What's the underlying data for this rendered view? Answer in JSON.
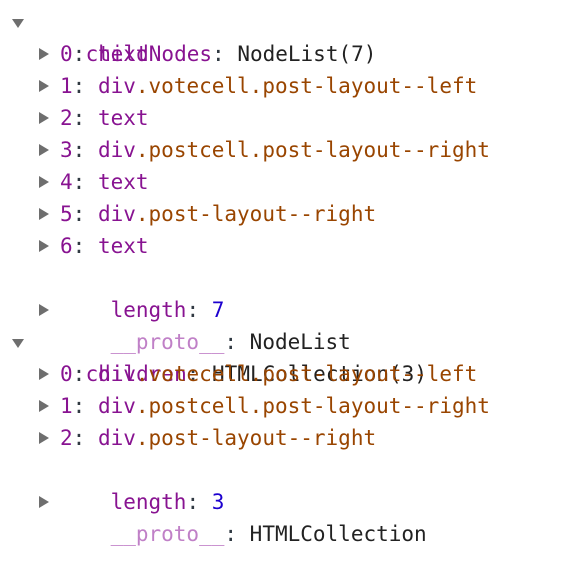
{
  "colors": {
    "key": "#881391",
    "proto_key": "#c080c7",
    "class_name": "#994500",
    "number": "#1c00cf",
    "text": "#222222"
  },
  "childNodes": {
    "key": "childNodes",
    "value": "NodeList(7)",
    "expanded": true,
    "items": [
      {
        "index": "0",
        "tag": "text",
        "classes": ""
      },
      {
        "index": "1",
        "tag": "div",
        "classes": ".votecell.post-layout--left"
      },
      {
        "index": "2",
        "tag": "text",
        "classes": ""
      },
      {
        "index": "3",
        "tag": "div",
        "classes": ".postcell.post-layout--right"
      },
      {
        "index": "4",
        "tag": "text",
        "classes": ""
      },
      {
        "index": "5",
        "tag": "div",
        "classes": ".post-layout--right"
      },
      {
        "index": "6",
        "tag": "text",
        "classes": ""
      }
    ],
    "length_key": "length",
    "length_value": "7",
    "proto_key": "__proto__",
    "proto_value": "NodeList"
  },
  "children": {
    "key": "children",
    "value": "HTMLCollection(3)",
    "expanded": true,
    "items": [
      {
        "index": "0",
        "tag": "div",
        "classes": ".votecell.post-layout--left"
      },
      {
        "index": "1",
        "tag": "div",
        "classes": ".postcell.post-layout--right"
      },
      {
        "index": "2",
        "tag": "div",
        "classes": ".post-layout--right"
      }
    ],
    "length_key": "length",
    "length_value": "3",
    "proto_key": "__proto__",
    "proto_value": "HTMLCollection"
  },
  "separator": ": "
}
